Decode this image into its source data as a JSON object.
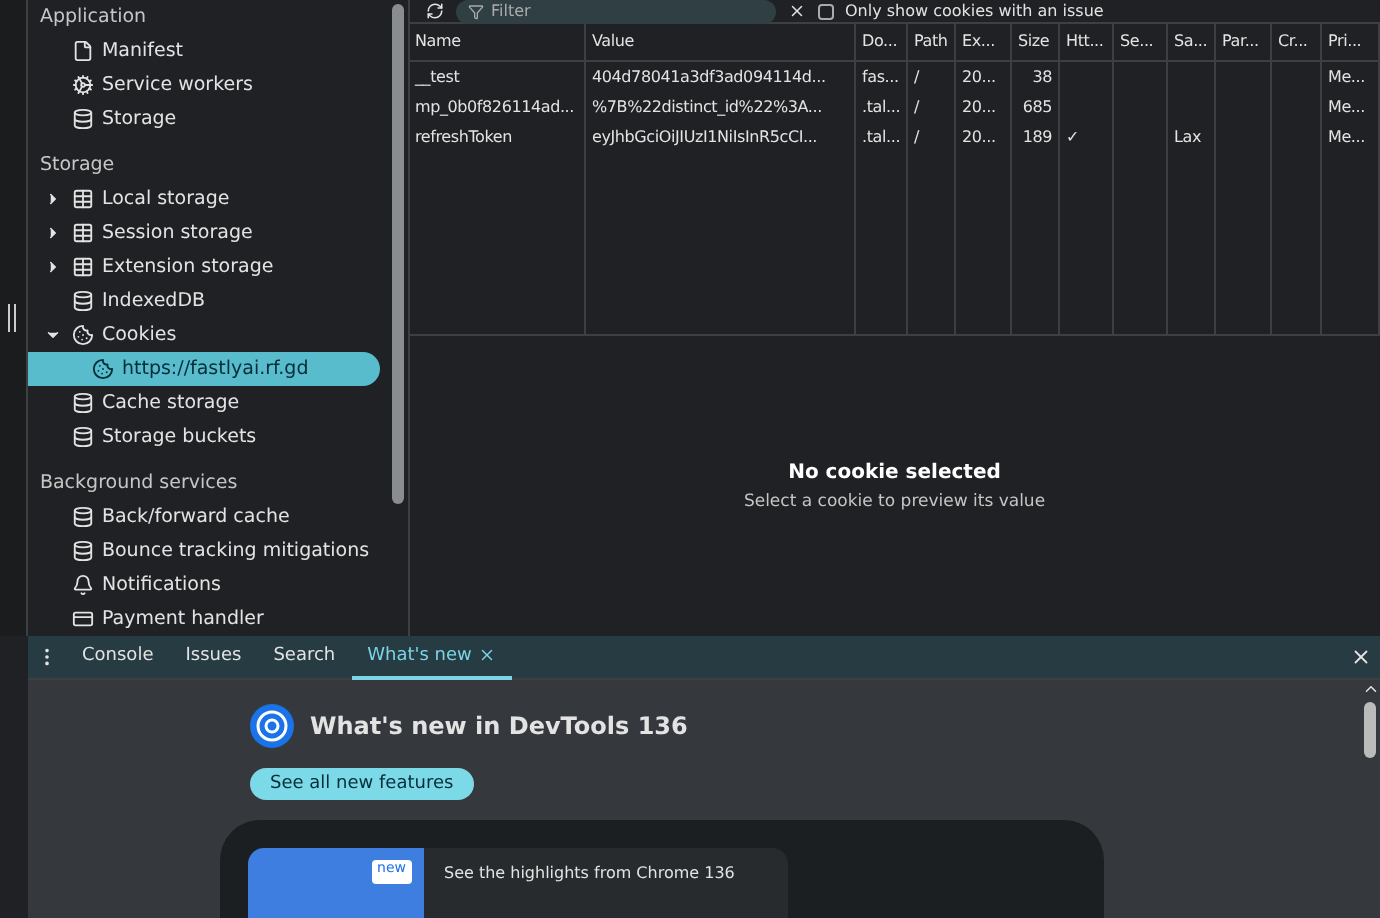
{
  "sidebar": {
    "sections": [
      {
        "title": "Application",
        "items": [
          {
            "kind": "file",
            "label": "Manifest",
            "selected": false
          },
          {
            "kind": "gears",
            "label": "Service workers",
            "selected": false
          },
          {
            "kind": "db",
            "label": "Storage",
            "selected": false
          }
        ]
      },
      {
        "title": "Storage",
        "items": [
          {
            "kind": "table",
            "label": "Local storage",
            "expanded": false,
            "selected": false
          },
          {
            "kind": "table",
            "label": "Session storage",
            "expanded": false,
            "selected": false
          },
          {
            "kind": "table",
            "label": "Extension storage",
            "expanded": false,
            "selected": false
          },
          {
            "kind": "db",
            "label": "IndexedDB",
            "selected": false
          },
          {
            "kind": "cookie",
            "label": "Cookies",
            "expanded": true,
            "selected": false,
            "children": [
              {
                "kind": "cookie",
                "label": "https://fastlyai.rf.gd",
                "selected": true
              }
            ]
          },
          {
            "kind": "db",
            "label": "Cache storage",
            "selected": false
          },
          {
            "kind": "db",
            "label": "Storage buckets",
            "selected": false
          }
        ]
      },
      {
        "title": "Background services",
        "items": [
          {
            "kind": "db",
            "label": "Back/forward cache",
            "selected": false
          },
          {
            "kind": "db",
            "label": "Bounce tracking mitigations",
            "selected": false
          },
          {
            "kind": "bell",
            "label": "Notifications",
            "selected": false
          },
          {
            "kind": "card",
            "label": "Payment handler",
            "selected": false
          }
        ]
      }
    ]
  },
  "toolbar": {
    "filter": {
      "placeholder": "Filter"
    },
    "only_issues": {
      "label": "Only show cookies with an issue",
      "checked": false
    }
  },
  "table": {
    "columns": [
      "Name",
      "Value",
      "Do...",
      "Path",
      "Ex...",
      "Size",
      "Htt...",
      "Se...",
      "Sa...",
      "Par...",
      "Cr...",
      "Pri..."
    ],
    "rows": [
      [
        "__test",
        "404d78041a3df3ad094114d...",
        "fas...",
        "/",
        "20...",
        "38",
        "",
        "",
        "",
        "",
        "",
        "Me..."
      ],
      [
        "mp_0b0f826114ad...",
        "%7B%22distinct_id%22%3A...",
        ".tal...",
        "/",
        "20...",
        "685",
        "",
        "",
        "",
        "",
        "",
        "Me..."
      ],
      [
        "refreshToken",
        "eyJhbGciOiJIUzI1NiIsInR5cCI...",
        ".tal...",
        "/",
        "20...",
        "189",
        "✓",
        "",
        "Lax",
        "",
        "",
        "Me..."
      ]
    ]
  },
  "preview": {
    "title": "No cookie selected",
    "subtitle": "Select a cookie to preview its value"
  },
  "drawer": {
    "tabs": [
      {
        "label": "Console",
        "selected": false
      },
      {
        "label": "Issues",
        "selected": false
      },
      {
        "label": "Search",
        "selected": false
      },
      {
        "label": "What's new",
        "selected": true,
        "closable": true
      }
    ],
    "heading": "What's new in DevTools 136",
    "button": "See all new features",
    "card": {
      "badge": "new",
      "text": "See the highlights from Chrome 136"
    }
  }
}
